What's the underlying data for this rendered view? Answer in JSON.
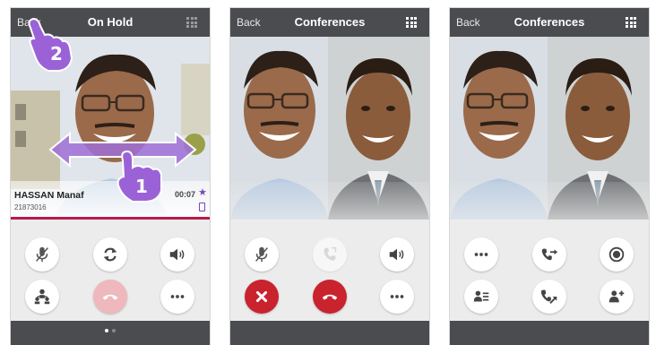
{
  "screens": [
    {
      "back_label": "Back",
      "title": "On Hold",
      "contact_name": "HASSAN Manaf",
      "contact_number": "21873016",
      "call_duration": "00:07",
      "icons": {
        "row1": [
          "mute-mic-icon",
          "swap-call-icon",
          "speaker-icon"
        ],
        "row2": [
          "conference-icon",
          "end-call-icon",
          "more-icon"
        ]
      },
      "page_indicator": {
        "pages": 2,
        "current": 1
      },
      "annotations": {
        "swipe_step": "1",
        "back_step": "2"
      }
    },
    {
      "back_label": "Back",
      "title": "Conferences",
      "icons": {
        "row1": [
          "mute-mic-icon",
          "add-call-icon",
          "speaker-icon"
        ],
        "row2": [
          "cancel-icon",
          "end-call-icon",
          "more-icon"
        ]
      }
    },
    {
      "back_label": "Back",
      "title": "Conferences",
      "icons": {
        "row1": [
          "more-icon",
          "transfer-icon",
          "record-icon"
        ],
        "row2": [
          "contact-list-icon",
          "call-forward-icon",
          "add-contact-icon"
        ]
      }
    }
  ],
  "colors": {
    "topbar": "#4b4c4f",
    "accent_red": "#c9232e",
    "on_hold_pink": "#eeb8bd",
    "accent_purple": "#7b45b9",
    "status_line": "#b71b4a"
  }
}
